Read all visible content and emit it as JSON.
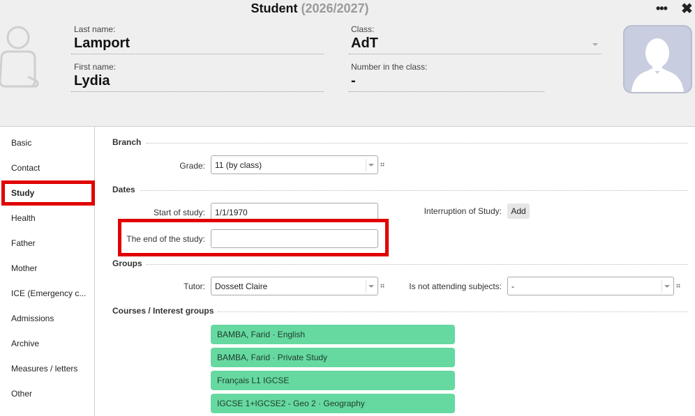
{
  "header": {
    "title": "Student",
    "year": "(2026/2027)",
    "menu_icon": "more-dots-icon",
    "close_icon": "close-icon",
    "last_name_label": "Last name:",
    "last_name": "Lamport",
    "first_name_label": "First name:",
    "first_name": "Lydia",
    "class_label": "Class:",
    "class_value": "AdT",
    "number_label": "Number in the class:",
    "number_value": "-"
  },
  "sidebar": {
    "items": [
      {
        "label": "Basic"
      },
      {
        "label": "Contact"
      },
      {
        "label": "Study"
      },
      {
        "label": "Health"
      },
      {
        "label": "Father"
      },
      {
        "label": "Mother"
      },
      {
        "label": "ICE (Emergency c..."
      },
      {
        "label": "Admissions"
      },
      {
        "label": "Archive"
      },
      {
        "label": "Measures / letters"
      },
      {
        "label": "Other"
      }
    ],
    "active": "Study"
  },
  "branch": {
    "title": "Branch",
    "grade_label": "Grade:",
    "grade_value": "11 (by class)",
    "hash": "⌗"
  },
  "dates": {
    "title": "Dates",
    "start_label": "Start of study:",
    "start_value": "1/1/1970",
    "end_label": "The end of the study:",
    "end_value": "",
    "interruption_label": "Interruption of Study:",
    "add_label": "Add"
  },
  "groups": {
    "title": "Groups",
    "tutor_label": "Tutor:",
    "tutor_value": "Dossett Claire",
    "not_attending_label": "Is not attending subjects:",
    "not_attending_value": "-",
    "hash": "⌗"
  },
  "courses": {
    "title": "Courses / Interest groups",
    "items": [
      {
        "label": "BAMBA, Farid · English"
      },
      {
        "label": "BAMBA, Farid · Private Study"
      },
      {
        "label": "Français L1 IGCSE"
      },
      {
        "label": "IGCSE 1+IGCSE2 - Geo 2 · Geography"
      }
    ],
    "color": "#66d9a0"
  },
  "colors": {
    "highlight": "#e00000",
    "header_bg": "#efefef"
  }
}
